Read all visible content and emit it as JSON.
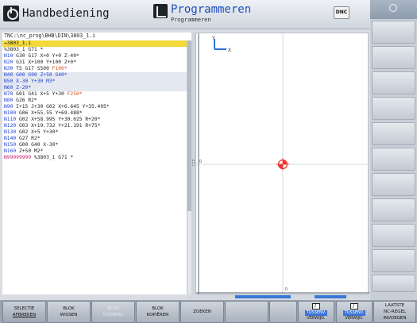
{
  "header": {
    "left_mode": "Handbediening",
    "right_mode": "Programmeren",
    "right_mode_sub": "Programmeren",
    "dnc_label": "DNC"
  },
  "program": {
    "path": "TNC:\\nc_prog\\BHB\\DIN\\3803_1.i",
    "current_marker": "→3803_1.i",
    "lines": [
      [
        {
          "t": "%3803_1 G71 *",
          "c": ""
        }
      ],
      [
        {
          "t": "N10",
          "c": "n"
        },
        {
          "t": " G30 G17 X+0 Y+0 Z-40*",
          "c": ""
        }
      ],
      [
        {
          "t": "N20",
          "c": "n"
        },
        {
          "t": " G31 X+100 Y+100 Z+0*",
          "c": ""
        }
      ],
      [
        {
          "t": "N30",
          "c": "n"
        },
        {
          "t": " T5 G17 S500 ",
          "c": ""
        },
        {
          "t": "F100*",
          "c": "f"
        }
      ],
      [
        {
          "t": "N40 G00 G90 Z+50 G40*",
          "c": "n"
        }
      ],
      [
        {
          "t": "N50 X-30 Y+30 M3*",
          "c": "n"
        }
      ],
      [
        {
          "t": "N60 Z-20*",
          "c": "n"
        }
      ],
      [
        {
          "t": "N70",
          "c": "n"
        },
        {
          "t": " G01 G41 X+5 Y+30 ",
          "c": ""
        },
        {
          "t": "F250*",
          "c": "f"
        }
      ],
      [
        {
          "t": "N80",
          "c": "n"
        },
        {
          "t": " G26 R2*",
          "c": ""
        }
      ],
      [
        {
          "t": "N90",
          "c": "n"
        },
        {
          "t": " I+15 J+30 G02 X+6.645 Y+35.495*",
          "c": ""
        }
      ],
      [
        {
          "t": "N100",
          "c": "n"
        },
        {
          "t": " G06 X+55.55 Y+69.488*",
          "c": ""
        }
      ],
      [
        {
          "t": "N110",
          "c": "n"
        },
        {
          "t": " G02 X+58.995 Y+30.025 R+20*",
          "c": ""
        }
      ],
      [
        {
          "t": "N120",
          "c": "n"
        },
        {
          "t": " G03 X+19.732 Y+21.191 R+75*",
          "c": ""
        }
      ],
      [
        {
          "t": "N130",
          "c": "n"
        },
        {
          "t": " G02 X+5 Y+30*",
          "c": ""
        }
      ],
      [
        {
          "t": "N140",
          "c": "n"
        },
        {
          "t": " G27 R2*",
          "c": ""
        }
      ],
      [
        {
          "t": "N150",
          "c": "n"
        },
        {
          "t": " G00 G40 X-30*",
          "c": ""
        }
      ],
      [
        {
          "t": "N160",
          "c": "n"
        },
        {
          "t": " Z+50 M2*",
          "c": ""
        }
      ],
      [
        {
          "t": "N99999999",
          "c": "m"
        },
        {
          "t": " %3803_1 G71 *",
          "c": ""
        }
      ]
    ]
  },
  "graphics": {
    "axis_y": "Y",
    "axis_x": "X",
    "origin_label": "0",
    "scroll_min_label": "0",
    "datum_color": "#e8392c",
    "axis_color": "#2f6fd8"
  },
  "softkeys": [
    {
      "l1": "SELECTIE",
      "l2": "AFBREKEN",
      "state": "sel",
      "ul": true
    },
    {
      "l1": "BLOK",
      "l2": "WISSEN",
      "state": "normal"
    },
    {
      "l1": "BLOK",
      "l2": "TUSSENV.",
      "state": "disabled"
    },
    {
      "l1": "BLOK",
      "l2": "KOPIËREN",
      "state": "normal"
    },
    {
      "l1": "ZOEKEN",
      "l2": "",
      "state": "normal"
    },
    {
      "l1": "",
      "l2": "",
      "state": "normal"
    },
    {
      "l1": "",
      "l2": "",
      "state": "normal"
    },
    {
      "l1": "TUSSENV.",
      "l2": "VERWIJD.",
      "state": "icon"
    },
    {
      "l1": "TUSSENV.",
      "l2": "VERWIJD.",
      "state": "icon"
    },
    {
      "l1": "LAATSTE",
      "l2": "NC-REGEL",
      "l3": "INVOEGEN",
      "state": "normal"
    }
  ]
}
